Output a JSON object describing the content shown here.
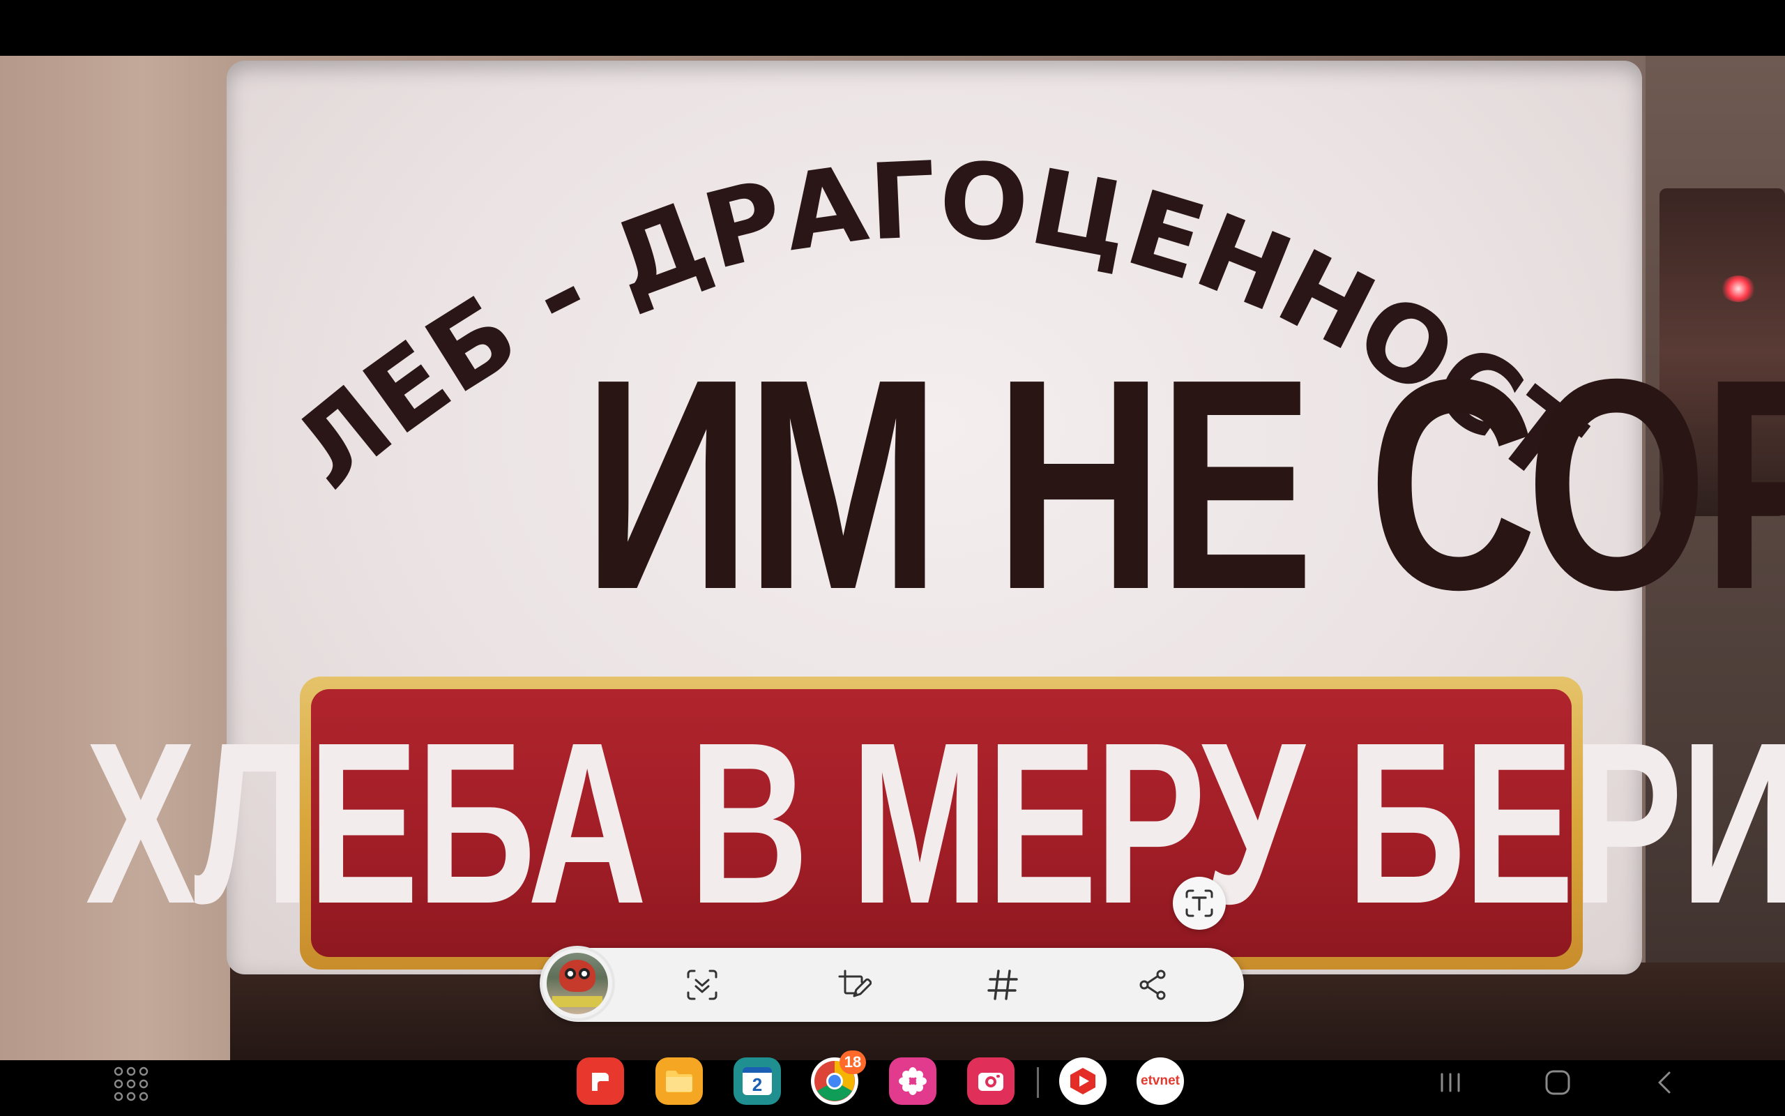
{
  "photo": {
    "sign": {
      "arc_line": "ХЛЕБ - ДРАГОЦЕННОСТЬ",
      "main_line": "ИМ НЕ СОРИ",
      "banner_line": "ХЛЕБА В МЕРУ БЕРИ"
    }
  },
  "toolbar": {
    "thumbnail": "screenshot-thumbnail",
    "buttons": [
      "scroll-capture",
      "edit-screenshot",
      "add-tags",
      "share"
    ]
  },
  "taskbar": {
    "apps": [
      {
        "name": "samsung-notes"
      },
      {
        "name": "my-files"
      },
      {
        "name": "calendar",
        "label": "2"
      },
      {
        "name": "chrome",
        "badge": "18"
      },
      {
        "name": "gallery"
      },
      {
        "name": "camera"
      },
      {
        "name": "youtube"
      },
      {
        "name": "etvnet",
        "label": "etvnet"
      }
    ]
  },
  "colors": {
    "banner_red": "#a21e27",
    "banner_gold": "#d9a63a",
    "sign_text": "#2a1515",
    "badge": "#ff6a2b"
  }
}
